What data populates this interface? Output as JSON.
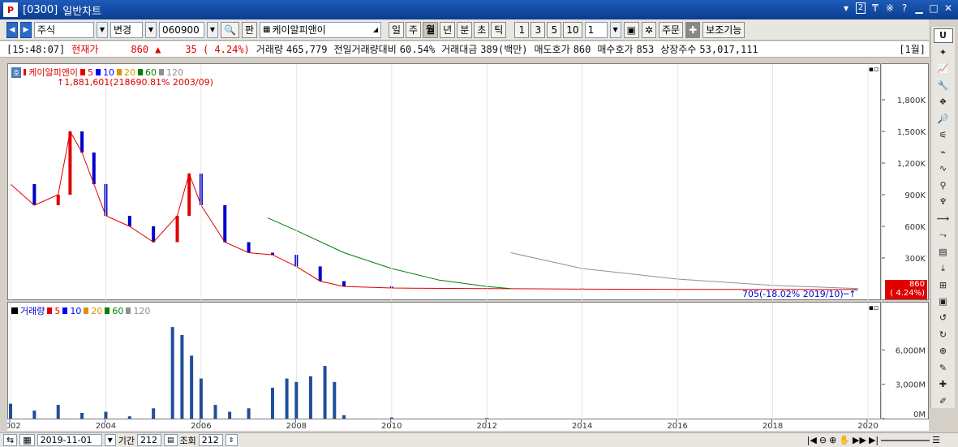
{
  "window": {
    "code": "[0300]",
    "title": "일반차트",
    "controls": {
      "number": "2",
      "pin": "₸",
      "settings": "※",
      "help": "?",
      "minimize": "▁",
      "maximize": "□",
      "close": "✕"
    }
  },
  "toolbar": {
    "market": "주식",
    "change": "변경",
    "stock_code": "060900",
    "pan": "판",
    "stock_name": "케이알피앤이",
    "periods": [
      "일",
      "주",
      "월",
      "년",
      "분",
      "초",
      "틱"
    ],
    "active_period": "월",
    "intervals": [
      "1",
      "3",
      "5",
      "10"
    ],
    "count": "1",
    "order": "주문",
    "aux": "보조기능"
  },
  "infobar": {
    "time": "[15:48:07]",
    "price_label": "현재가",
    "price": "860",
    "change": "35 ( 4.24%)",
    "volume_label": "거래량",
    "volume": "465,779",
    "prev_vol_label": "전일거래량대비",
    "prev_vol": "60.54%",
    "amount_label": "거래대금",
    "amount": "389(백만)",
    "ask_label": "매도호가",
    "ask": "860",
    "bid_label": "매수호가",
    "bid": "853",
    "shares_label": "상장주수",
    "shares": "53,017,111",
    "period_tag": "[1월]"
  },
  "price_legend": {
    "name": "케이알피앤이",
    "ma": [
      "5",
      "10",
      "20",
      "60",
      "120"
    ]
  },
  "volume_legend": {
    "name": "거래량",
    "ma": [
      "5",
      "10",
      "20",
      "60",
      "120"
    ]
  },
  "annotations": {
    "max": "1,881,601(218690.81% 2003/09)",
    "last": "705(-18.02% 2019/10)",
    "price_tag": "860",
    "price_tag_pct": "( 4.24%)"
  },
  "colors": {
    "up": "#e00000",
    "down": "#0000cc",
    "ma5": "#e00000",
    "ma10": "#0000ff",
    "ma20": "#e09000",
    "ma60": "#008000",
    "ma120": "#909090"
  },
  "chart_data": [
    {
      "type": "candlestick",
      "title": "케이알피앤이",
      "yticks": [
        "1,800K",
        "1,500K",
        "1,200K",
        "900K",
        "600K",
        "300K"
      ],
      "ytick_values": [
        1800000,
        1500000,
        1200000,
        900000,
        600000,
        300000
      ],
      "ylim": [
        0,
        2000000
      ],
      "xlim": [
        2002.0,
        2020.0
      ],
      "x": [
        2002.0,
        2002.5,
        2003.0,
        2003.25,
        2003.5,
        2003.75,
        2004.0,
        2004.5,
        2005.0,
        2005.5,
        2005.75,
        2006.0,
        2006.5,
        2007.0,
        2007.5,
        2008.0,
        2008.5,
        2009.0,
        2010.0,
        2012.0,
        2014.0,
        2016.0,
        2018.0,
        2019.75
      ],
      "close": [
        1000000,
        800000,
        900000,
        1500000,
        1300000,
        1000000,
        700000,
        600000,
        450000,
        700000,
        1100000,
        800000,
        450000,
        350000,
        330000,
        220000,
        80000,
        30000,
        15000,
        10000,
        5000,
        3000,
        1500,
        705
      ],
      "ma_series": [
        {
          "name": "60",
          "x": [
            2007.4,
            2008,
            2009,
            2010,
            2011,
            2012,
            2012.5
          ],
          "y": [
            680000,
            560000,
            350000,
            200000,
            90000,
            30000,
            10000
          ]
        },
        {
          "name": "120",
          "x": [
            2012.5,
            2014,
            2016,
            2018,
            2019.8
          ],
          "y": [
            350000,
            200000,
            100000,
            40000,
            10000
          ]
        }
      ]
    },
    {
      "type": "bar",
      "title": "거래량",
      "yticks": [
        "6,000M",
        "3,000M",
        "0M"
      ],
      "ytick_values": [
        6000000000,
        3000000000,
        0
      ],
      "ylim": [
        0,
        9000000000
      ],
      "xticks": [
        "2002",
        "2004",
        "2006",
        "2008",
        "2010",
        "2012",
        "2014",
        "2016",
        "2018",
        "2020"
      ],
      "x": [
        2002.0,
        2002.5,
        2003.0,
        2003.5,
        2004.0,
        2004.5,
        2005.0,
        2005.4,
        2005.6,
        2005.8,
        2006.0,
        2006.3,
        2006.6,
        2007.0,
        2007.5,
        2007.8,
        2008.0,
        2008.3,
        2008.6,
        2008.8,
        2009.0,
        2010.0,
        2012.0
      ],
      "values": [
        1300000000,
        700000000,
        1200000000,
        500000000,
        600000000,
        200000000,
        900000000,
        8000000000,
        7300000000,
        5500000000,
        3500000000,
        1200000000,
        600000000,
        900000000,
        2700000000,
        3500000000,
        3200000000,
        3700000000,
        4600000000,
        3200000000,
        300000000,
        100000000,
        50000000
      ]
    }
  ],
  "bottombar": {
    "date": "2019-11-01",
    "period_label": "기간",
    "period": "212",
    "query_label": "조회",
    "query": "212"
  }
}
